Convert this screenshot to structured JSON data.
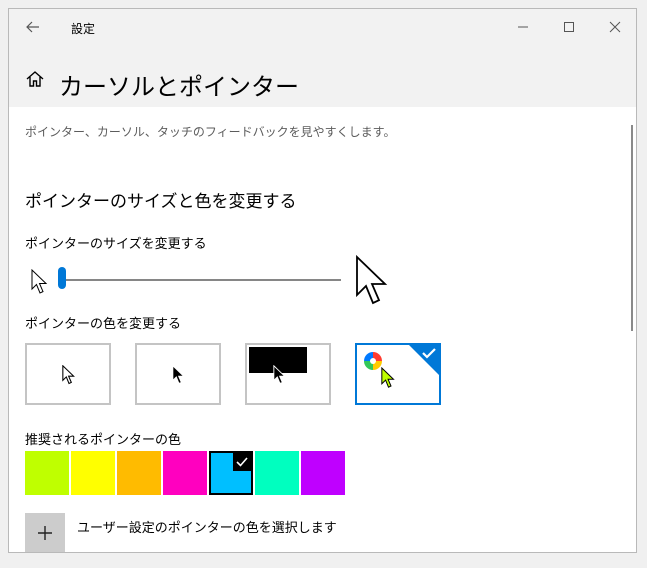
{
  "window": {
    "title": "設定"
  },
  "header": {
    "title": "カーソルとポインター"
  },
  "page": {
    "description": "ポインター、カーソル、タッチのフィードバックを見やすくします。",
    "section_heading": "ポインターのサイズと色を変更する",
    "size_label": "ポインターのサイズを変更する",
    "size_value": 1,
    "color_label": "ポインターの色を変更する",
    "recommended_label": "推奨されるポインターの色",
    "add_custom_label": "ユーザー設定のポインターの色を選択します"
  },
  "pointer_color_options": [
    {
      "name": "white"
    },
    {
      "name": "black"
    },
    {
      "name": "inverted"
    },
    {
      "name": "custom",
      "selected": true
    }
  ],
  "recommended_colors": [
    {
      "color": "#bfff00"
    },
    {
      "color": "#ffff00"
    },
    {
      "color": "#ffbb00"
    },
    {
      "color": "#ff00bf"
    },
    {
      "color": "#00bfff",
      "selected": true
    },
    {
      "color": "#00ffbf"
    },
    {
      "color": "#bf00ff"
    }
  ],
  "colors": {
    "accent": "#0078d7",
    "custom_pointer": "#bfff00"
  }
}
